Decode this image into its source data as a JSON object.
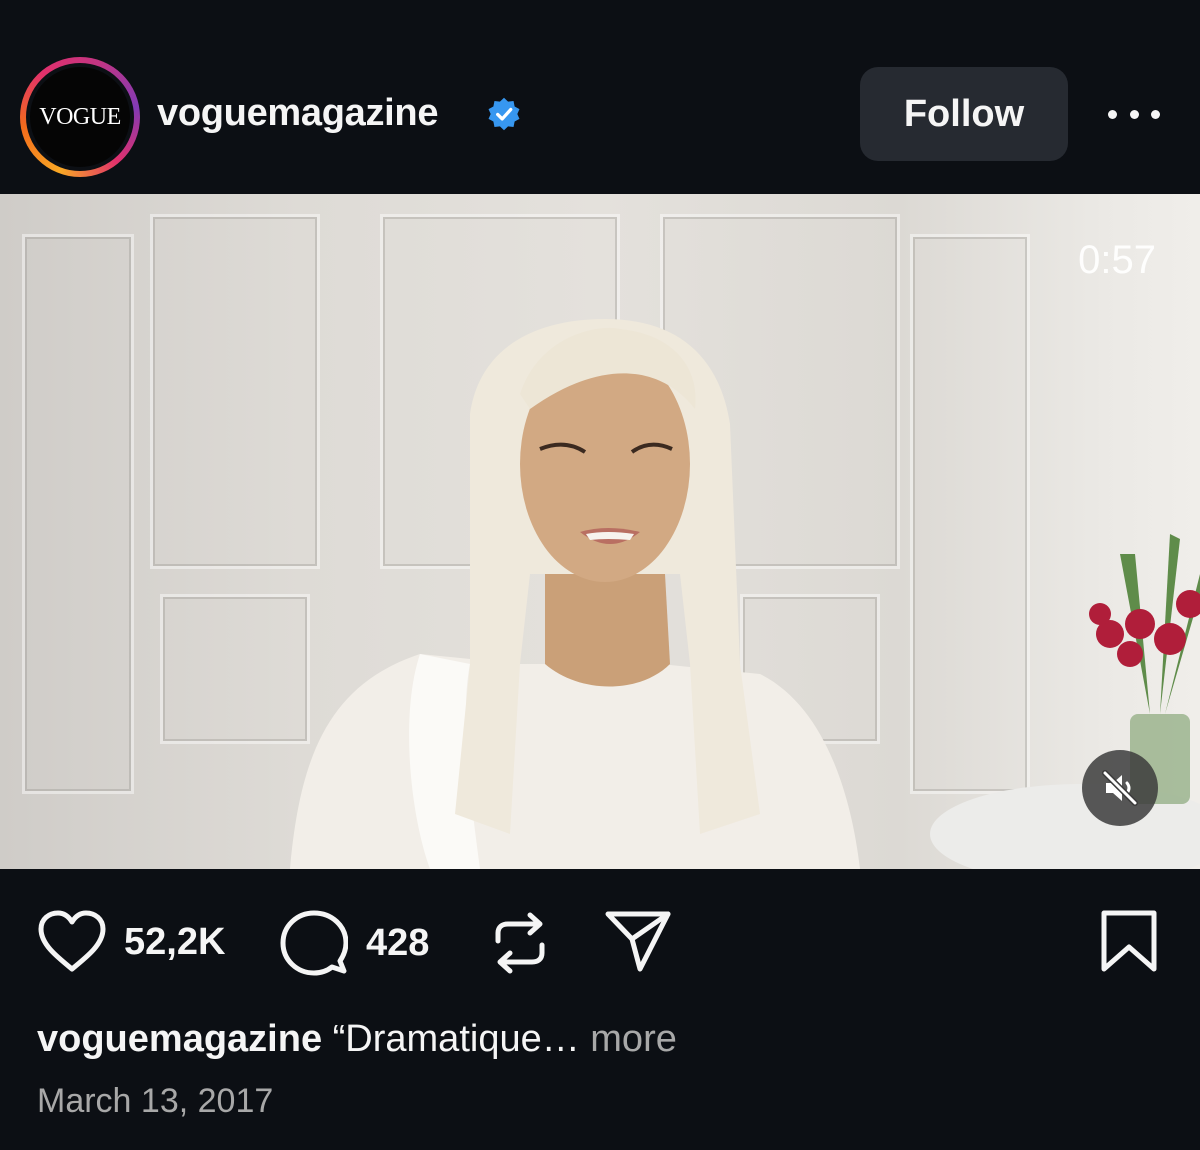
{
  "header": {
    "avatar_text": "VOGUE",
    "username": "voguemagazine",
    "follow_label": "Follow",
    "icons": {
      "verified": "verified-badge-icon",
      "more": "more-options-icon"
    },
    "colors": {
      "verified": "#3797f0",
      "follow_bg": "#262a31"
    }
  },
  "video": {
    "duration": "0:57",
    "muted": true,
    "icons": {
      "mute": "speaker-muted-icon"
    }
  },
  "actions": {
    "likes": "52,2K",
    "comments": "428",
    "icons": {
      "like": "heart-icon",
      "comment": "comment-icon",
      "repost": "repost-icon",
      "share": "send-icon",
      "save": "bookmark-icon"
    }
  },
  "caption": {
    "username": "voguemagazine",
    "text": "“Dramatique…",
    "more_label": "more"
  },
  "date": "March 13, 2017"
}
